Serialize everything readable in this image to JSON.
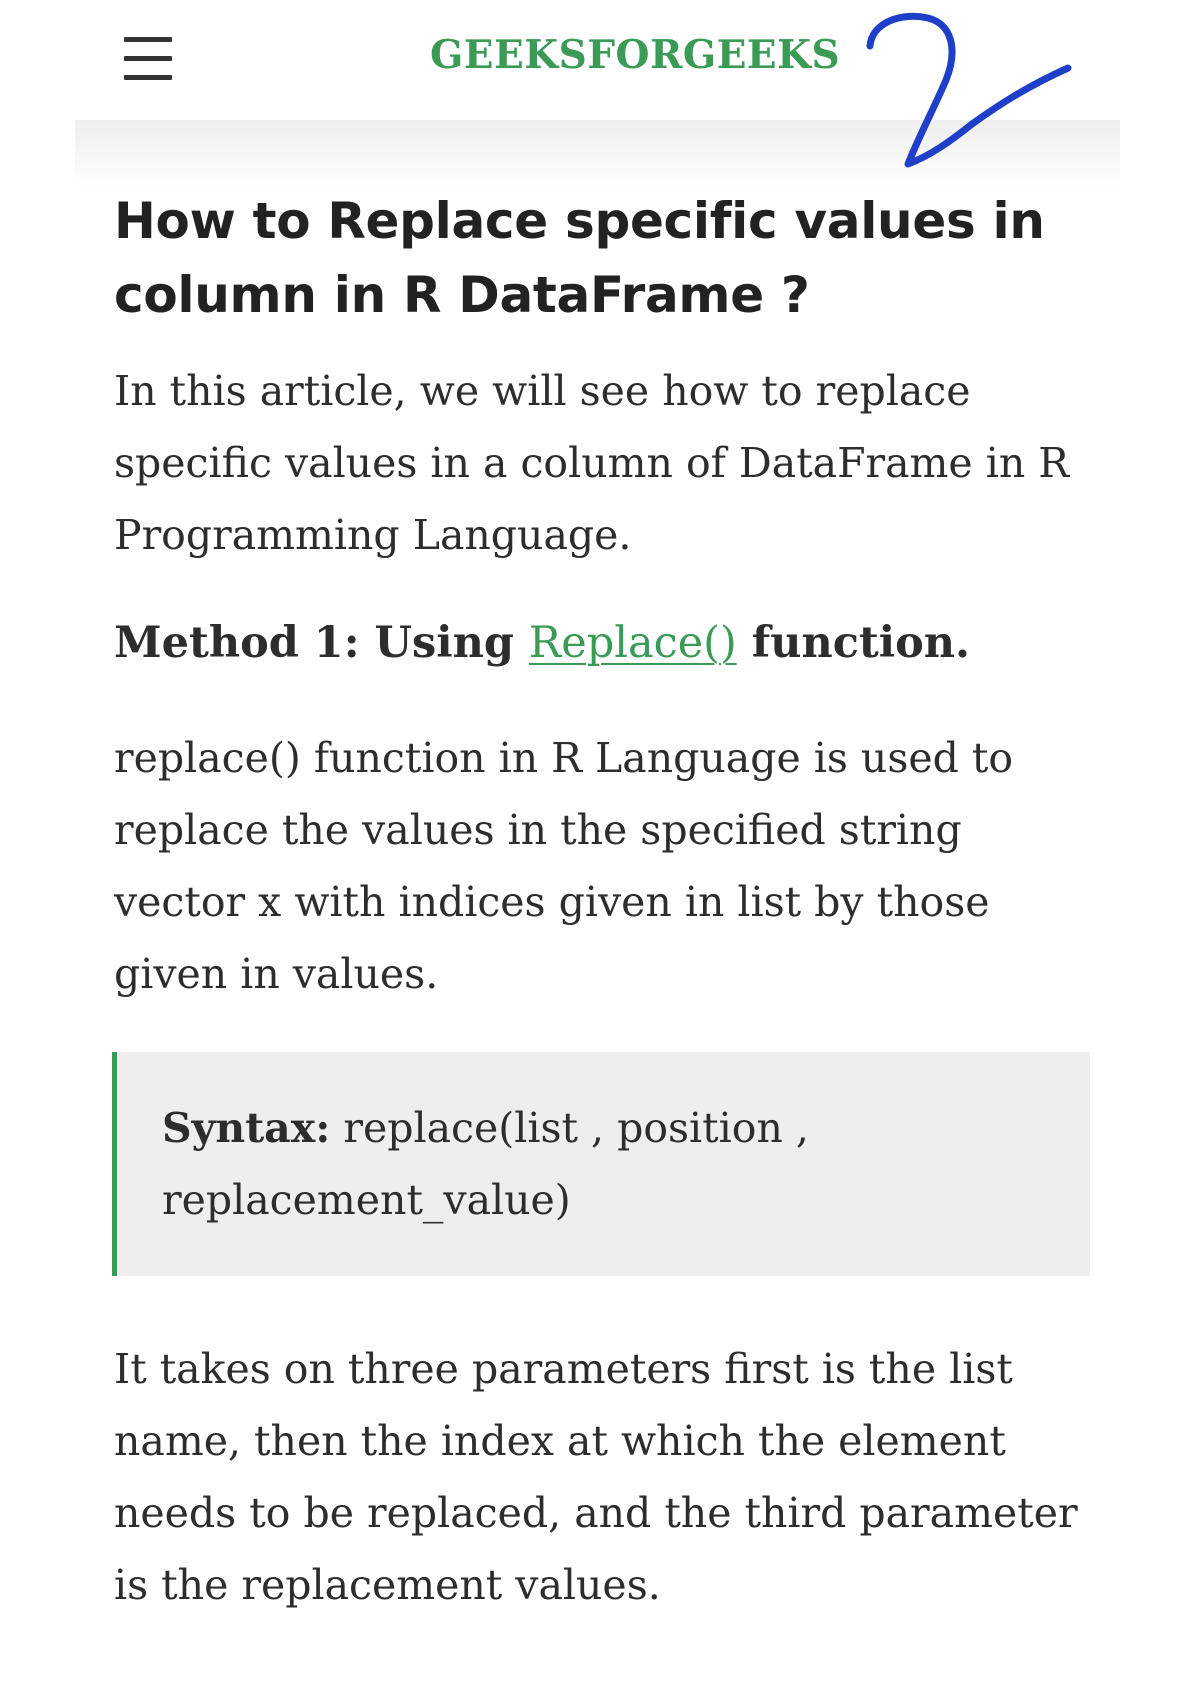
{
  "header": {
    "menu_icon": "hamburger-menu-icon",
    "logo_text": "GEEKSFORGEEKS",
    "brand_color": "#3a9a56",
    "annotation_mark": "2"
  },
  "article": {
    "title": "How to Replace specific values in column in R DataFrame ?",
    "intro": "In this article, we will see how to replace specific values in a column of DataFrame in R Programming Language.",
    "method_heading": {
      "prefix": "Method 1: Using ",
      "link_text": "Replace()",
      "suffix": " function."
    },
    "replace_description": "replace() function in R Language is used to replace the values in the specified string vector x with indices given in list by those given in values.",
    "syntax": {
      "label": "Syntax:",
      "code": " replace(list , position , replacement_value)"
    },
    "parameters_description": "It takes on three parameters first is the list name, then the index at which the element needs to be replaced, and the third parameter is the replacement values."
  }
}
